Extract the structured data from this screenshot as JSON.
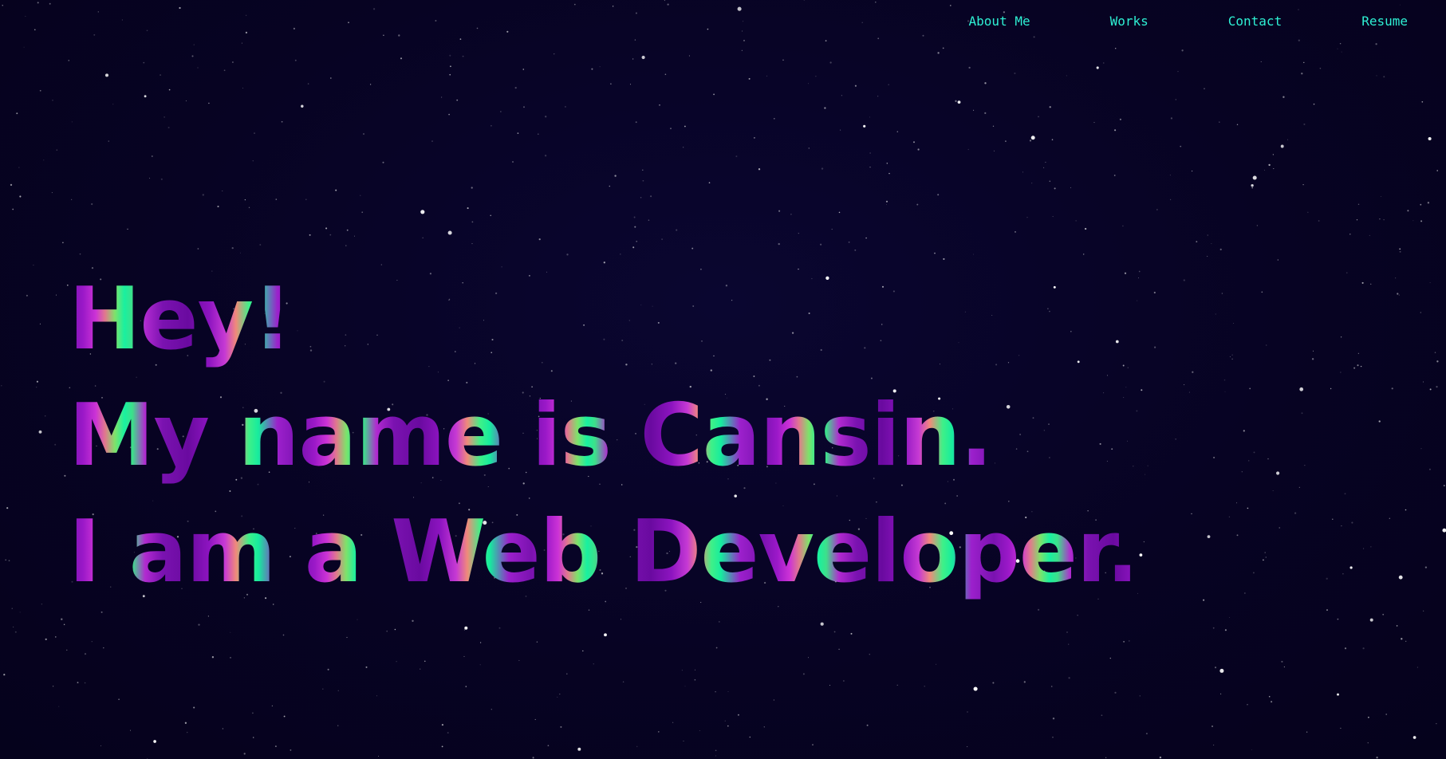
{
  "nav": {
    "items": [
      {
        "label": "About Me"
      },
      {
        "label": "Works"
      },
      {
        "label": "Contact"
      },
      {
        "label": "Resume"
      }
    ]
  },
  "hero": {
    "line1": "Hey!",
    "line2": "My name is Cansin.",
    "line3": "I am a Web Developer."
  },
  "colors": {
    "background": "#070323",
    "nav_text": "#2ef0d4",
    "gradient_purple": "#7a12b0",
    "gradient_magenta": "#cc33d6",
    "gradient_green": "#19f0a0"
  }
}
